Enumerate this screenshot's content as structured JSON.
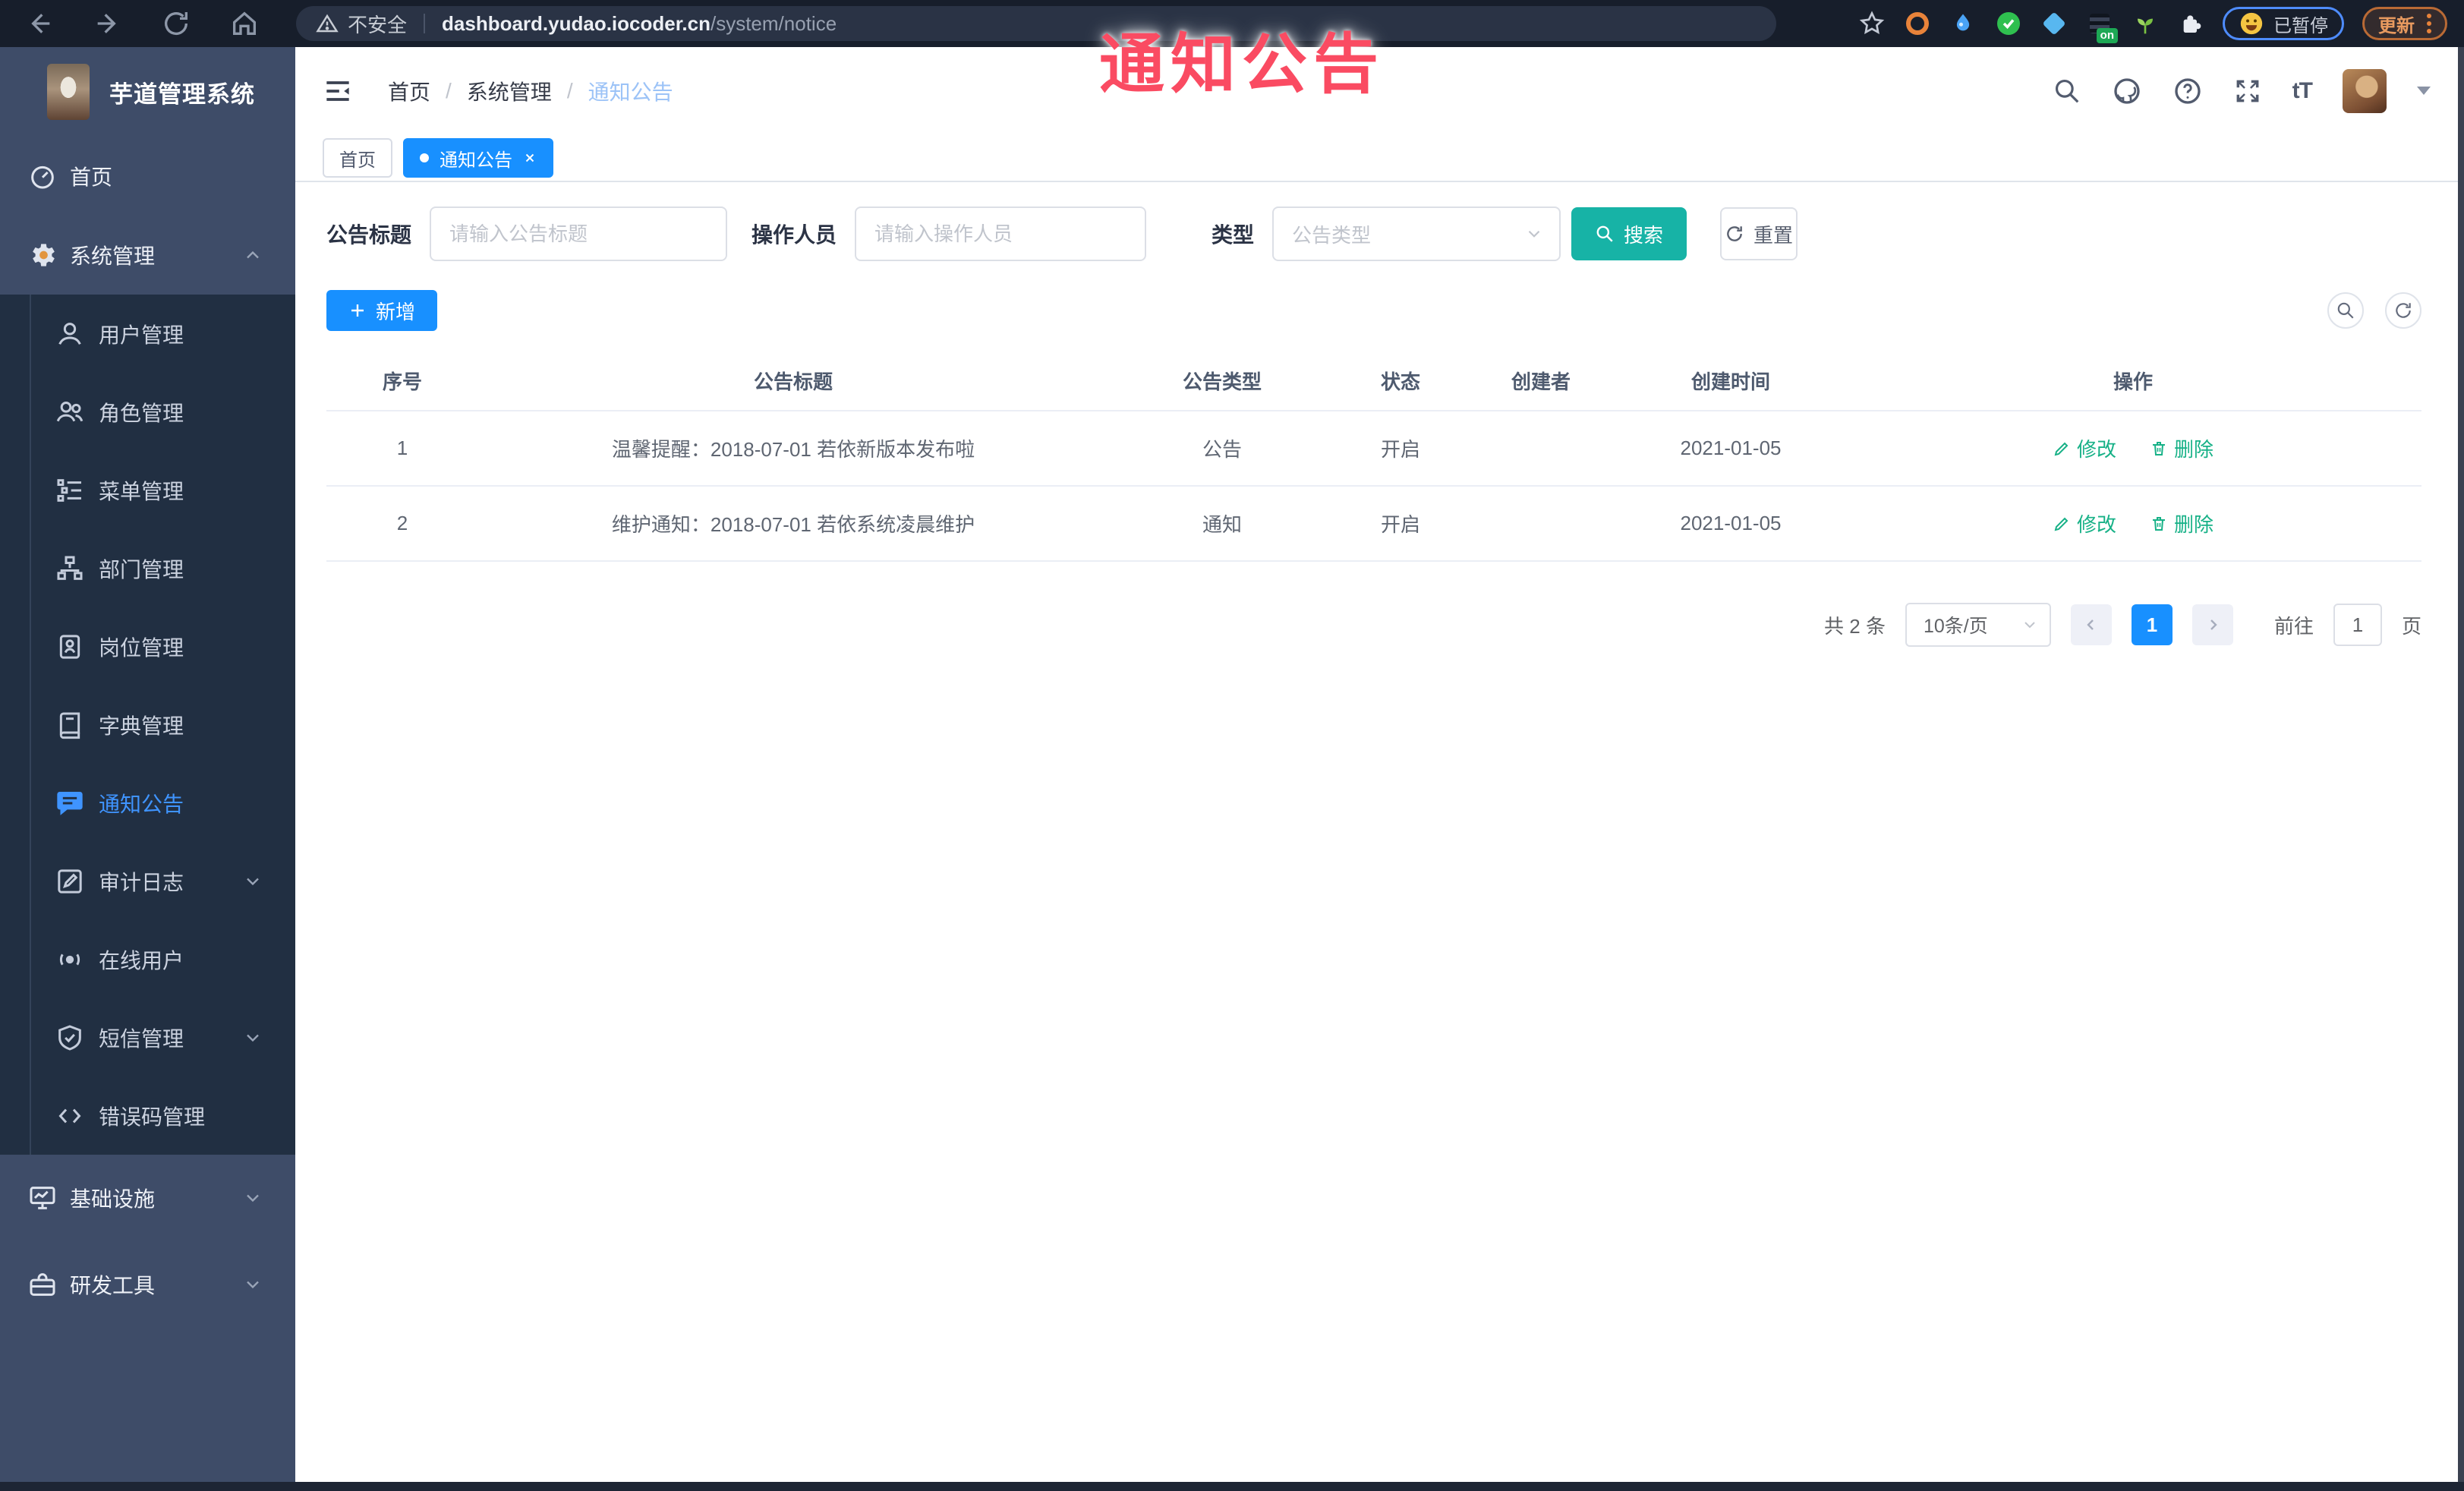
{
  "colors": {
    "accent_blue": "#1890ff",
    "teal": "#17b3a6",
    "action_green": "#17b187",
    "watermark_pink": "#fa4b62",
    "sidebar_bg": "#3e4c68",
    "submenu_bg": "#212f42",
    "active_blue": "#3f94ff",
    "browser_bar_bg": "#171e2b"
  },
  "overlay": {
    "watermark": "通知公告"
  },
  "browser": {
    "security_label": "不安全",
    "url_host": "dashboard.yudao.iocoder.cn",
    "url_path": "/system/notice",
    "extension_badge": "on",
    "profile_chip": "已暂停",
    "update_button": "更新"
  },
  "sidebar": {
    "logo_title": "芋道管理系统",
    "items": [
      {
        "label": "首页"
      },
      {
        "label": "系统管理"
      },
      {
        "label": "用户管理"
      },
      {
        "label": "角色管理"
      },
      {
        "label": "菜单管理"
      },
      {
        "label": "部门管理"
      },
      {
        "label": "岗位管理"
      },
      {
        "label": "字典管理"
      },
      {
        "label": "通知公告"
      },
      {
        "label": "审计日志"
      },
      {
        "label": "在线用户"
      },
      {
        "label": "短信管理"
      },
      {
        "label": "错误码管理"
      },
      {
        "label": "基础设施"
      },
      {
        "label": "研发工具"
      }
    ]
  },
  "header": {
    "breadcrumbs": [
      "首页",
      "系统管理",
      "通知公告"
    ],
    "font_size_icon_label": "tT"
  },
  "tabs": [
    {
      "label": "首页"
    },
    {
      "label": "通知公告"
    }
  ],
  "filters": {
    "title_label": "公告标题",
    "title_placeholder": "请输入公告标题",
    "operator_label": "操作人员",
    "operator_placeholder": "请输入操作人员",
    "type_label": "类型",
    "type_placeholder": "公告类型",
    "search_label": "搜索",
    "reset_label": "重置"
  },
  "toolbar": {
    "add_label": "新增"
  },
  "table": {
    "columns": [
      "序号",
      "公告标题",
      "公告类型",
      "状态",
      "创建者",
      "创建时间",
      "操作"
    ],
    "rows": [
      {
        "index": "1",
        "title": "温馨提醒：2018-07-01 若依新版本发布啦",
        "type": "公告",
        "status": "开启",
        "creator": "",
        "created": "2021-01-05"
      },
      {
        "index": "2",
        "title": "维护通知：2018-07-01 若依系统凌晨维护",
        "type": "通知",
        "status": "开启",
        "creator": "",
        "created": "2021-01-05"
      }
    ],
    "actions": {
      "edit": "修改",
      "delete": "删除"
    }
  },
  "pagination": {
    "total_text": "共 2 条",
    "page_size": "10条/页",
    "current_page": "1",
    "goto_label": "前往",
    "goto_value": "1",
    "page_unit": "页"
  }
}
